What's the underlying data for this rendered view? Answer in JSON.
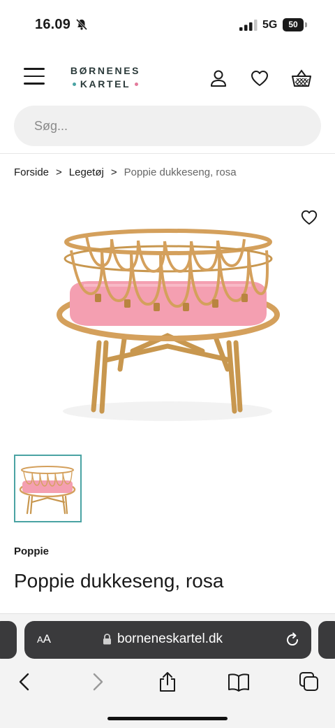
{
  "status_bar": {
    "time": "16.09",
    "network": "5G",
    "battery": "50"
  },
  "header": {
    "logo_line1": "BØRNENES",
    "logo_line2": "KARTEL",
    "logo_dot_left_color": "#4aa3a3",
    "logo_dot_right_color": "#e37b9b",
    "icons": [
      "menu-icon",
      "account-icon",
      "heart-icon",
      "basket-icon"
    ]
  },
  "search": {
    "placeholder": "Søg..."
  },
  "breadcrumb": {
    "items": [
      {
        "label": "Forside"
      },
      {
        "label": "Legetøj"
      }
    ],
    "separator": ">",
    "current": "Poppie dukkeseng, rosa"
  },
  "product": {
    "brand": "Poppie",
    "title": "Poppie dukkeseng, rosa",
    "accent_color": "#4aa3a3"
  },
  "browser": {
    "aa_label_small": "A",
    "aa_label": "A",
    "url": "borneneskartel.dk"
  }
}
